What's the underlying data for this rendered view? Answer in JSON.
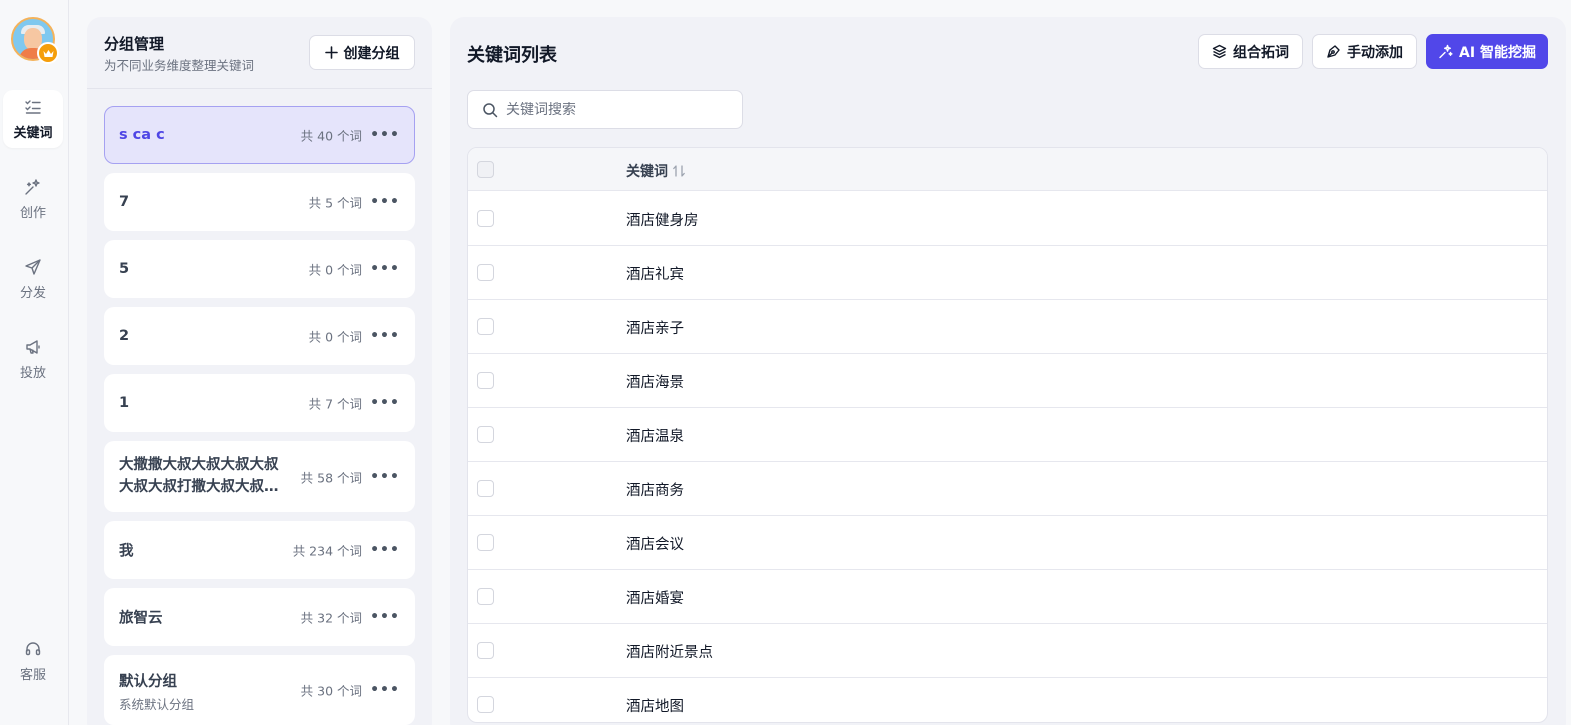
{
  "sidebar": {
    "items": [
      {
        "label": "关键词",
        "icon": "list-check-icon",
        "active": true
      },
      {
        "label": "创作",
        "icon": "sparkle-wand-icon",
        "active": false
      },
      {
        "label": "分发",
        "icon": "paper-plane-icon",
        "active": false
      },
      {
        "label": "投放",
        "icon": "megaphone-icon",
        "active": false
      }
    ],
    "support": {
      "label": "客服",
      "icon": "headset-icon"
    }
  },
  "groups_panel": {
    "title": "分组管理",
    "subtitle": "为不同业务维度整理关键词",
    "create_label": "创建分组",
    "items": [
      {
        "name": "s ca c",
        "count": "共 40 个词",
        "active": true
      },
      {
        "name": "7",
        "count": "共 5 个词"
      },
      {
        "name": "5",
        "count": "共 0 个词"
      },
      {
        "name": "2",
        "count": "共 0 个词"
      },
      {
        "name": "1",
        "count": "共 7 个词"
      },
      {
        "name": "大撒撒大叔大叔大叔大叔大叔大叔打撒大叔大叔大叔",
        "count": "共 58 个词"
      },
      {
        "name": "我",
        "count": "共 234 个词"
      },
      {
        "name": "旅智云",
        "count": "共 32 个词"
      },
      {
        "name": "默认分组",
        "desc": "系统默认分组",
        "count": "共 30 个词"
      }
    ]
  },
  "keywords_panel": {
    "title": "关键词列表",
    "buttons": {
      "combine": "组合拓词",
      "manual": "手动添加",
      "ai": "AI 智能挖掘"
    },
    "search": {
      "placeholder": "关键词搜索",
      "value": ""
    },
    "table": {
      "header": "关键词",
      "rows": [
        "酒店健身房",
        "酒店礼宾",
        "酒店亲子",
        "酒店海景",
        "酒店温泉",
        "酒店商务",
        "酒店会议",
        "酒店婚宴",
        "酒店附近景点",
        "酒店地图"
      ]
    }
  },
  "colors": {
    "accent": "#5147e9",
    "active_group_bg": "#e5e4fb",
    "active_group_text": "#4f46e5",
    "badge": "#f59e0b"
  }
}
